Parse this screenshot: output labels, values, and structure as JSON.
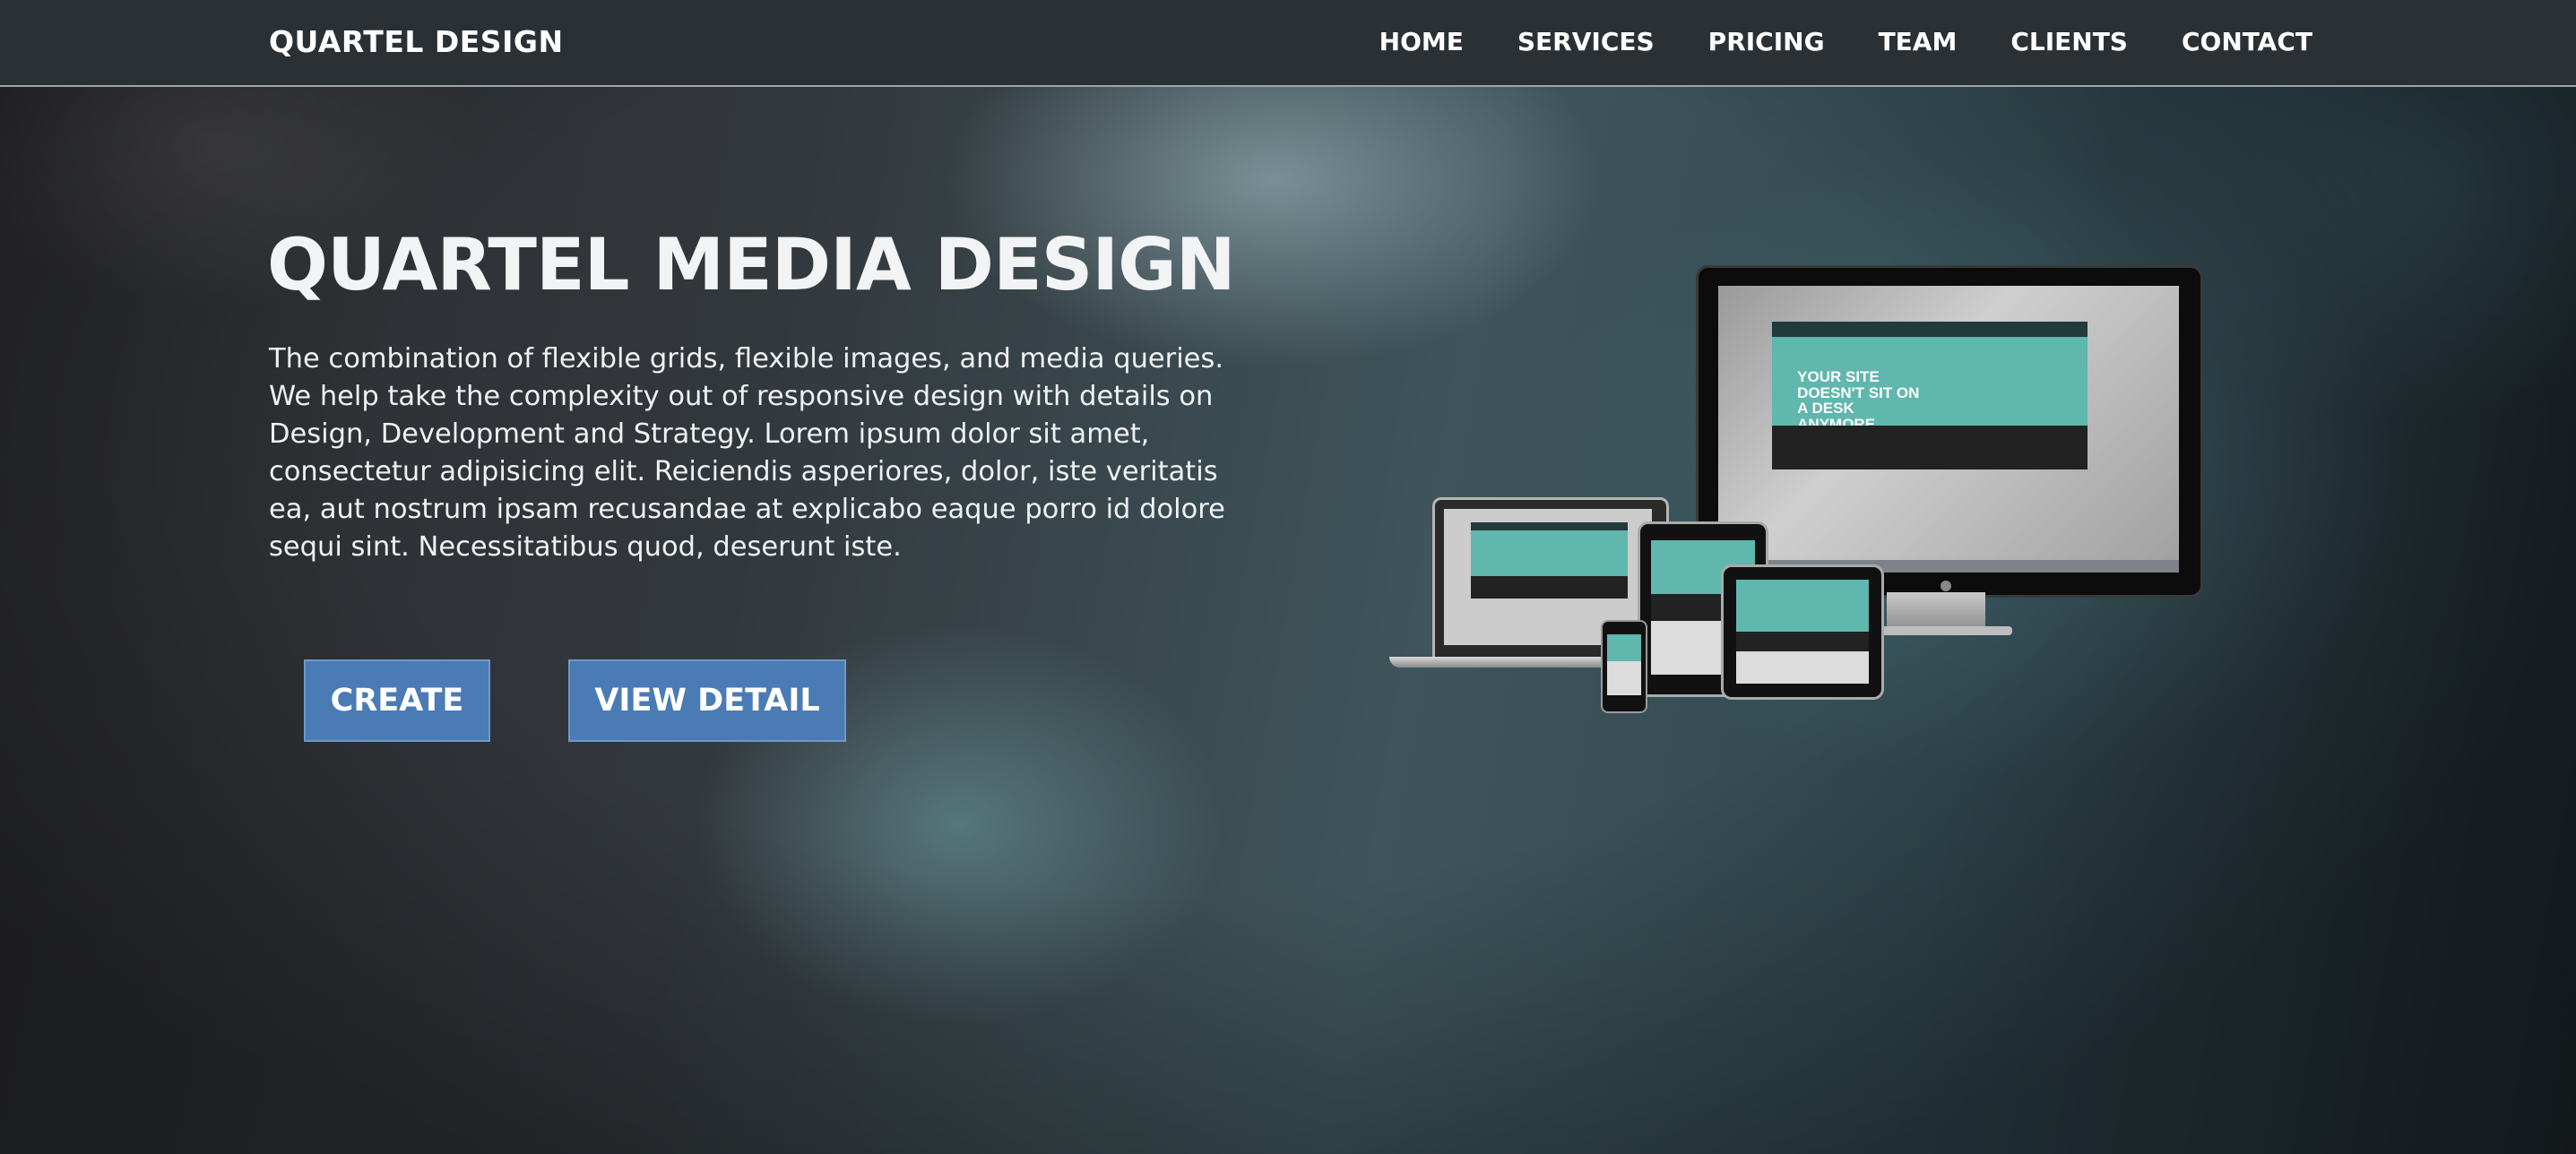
{
  "nav": {
    "brand": "QUARTEL DESIGN",
    "items": [
      {
        "label": "HOME"
      },
      {
        "label": "SERVICES"
      },
      {
        "label": "PRICING"
      },
      {
        "label": "TEAM"
      },
      {
        "label": "CLIENTS"
      },
      {
        "label": "CONTACT"
      }
    ]
  },
  "hero": {
    "title": "QUARTEL MEDIA DESIGN",
    "description": "The combination of flexible grids, flexible images, and media queries. We help take the complexity out of responsive design with details on Design, Development and Strategy. Lorem ipsum dolor sit amet, consectetur adipisicing elit. Reiciendis asperiores, dolor, iste veritatis ea, aut nostrum ipsam recusandae at explicabo eaque porro id dolore sequi sint. Necessitatibus quod, deserunt iste.",
    "buttons": {
      "create": "CREATE",
      "view_detail": "VIEW DETAIL"
    },
    "device_image": {
      "screen_text": "YOUR SITE DOESN'T SIT ON A DESK ANYMORE"
    }
  },
  "colors": {
    "nav_bg": "#2b3035",
    "button_bg": "#4a7bb4",
    "screen_accent": "#5fb7ad"
  }
}
